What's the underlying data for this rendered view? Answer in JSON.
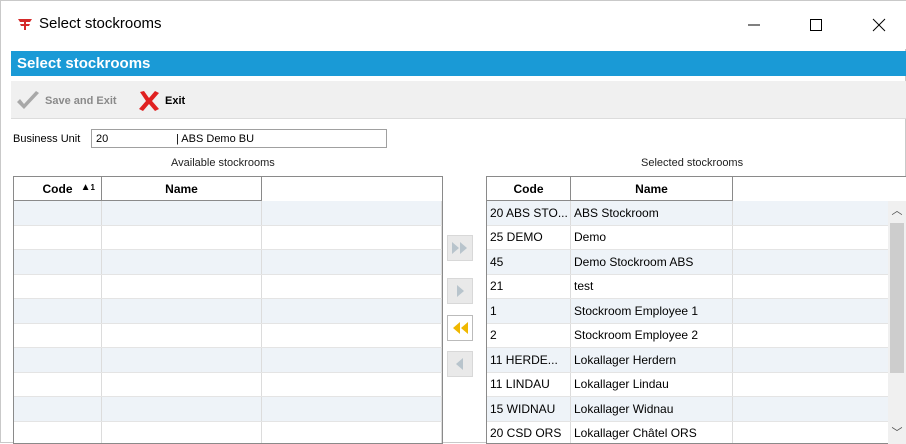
{
  "window": {
    "title": "Select stockrooms",
    "min_icon": "minimize-icon",
    "max_icon": "maximize-icon",
    "close_icon": "close-icon"
  },
  "header_band": {
    "title": "Select stockrooms",
    "color": "#1a9ad6"
  },
  "toolbar": {
    "save_exit_label": "Save and Exit",
    "exit_label": "Exit"
  },
  "business_unit": {
    "label": "Business Unit",
    "code": "20",
    "name": "| ABS Demo BU"
  },
  "available": {
    "caption": "Available stockrooms",
    "columns": [
      "Code",
      "Name"
    ],
    "sort_indicator": "1",
    "rows": []
  },
  "selected": {
    "caption": "Selected stockrooms",
    "columns": [
      "Code",
      "Name"
    ],
    "rows": [
      {
        "code": "20 ABS STO...",
        "name": "ABS Stockroom"
      },
      {
        "code": "25 DEMO",
        "name": "Demo"
      },
      {
        "code": "45",
        "name": "Demo Stockroom ABS"
      },
      {
        "code": "21",
        "name": "test"
      },
      {
        "code": "1",
        "name": "Stockroom Employee 1"
      },
      {
        "code": "2",
        "name": "Stockroom Employee 2"
      },
      {
        "code": "11 HERDE...",
        "name": "Lokallager Herdern"
      },
      {
        "code": "11 LINDAU",
        "name": "Lokallager Lindau"
      },
      {
        "code": "15 WIDNAU",
        "name": "Lokallager Widnau"
      },
      {
        "code": "20 CSD ORS",
        "name": "Lokallager Châtel ORS"
      }
    ]
  },
  "transfer_buttons": [
    "move-all-right-icon",
    "move-right-icon",
    "move-all-left-icon",
    "move-left-icon"
  ]
}
